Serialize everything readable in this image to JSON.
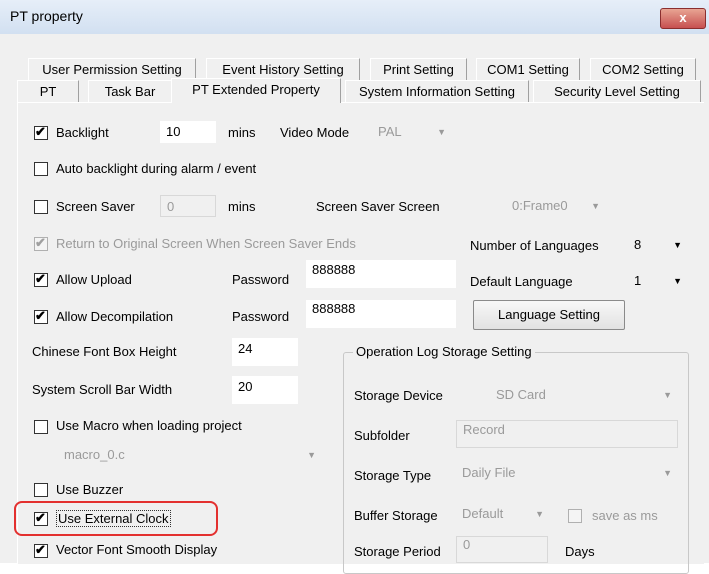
{
  "window": {
    "title": "PT property",
    "close_label": "x"
  },
  "tabs": {
    "row1": [
      "User Permission Setting",
      "Event History Setting",
      "Print Setting",
      "COM1 Setting",
      "COM2 Setting"
    ],
    "row2": [
      "PT",
      "Task Bar",
      "PT Extended Property",
      "System Information Setting",
      "Security Level Setting"
    ],
    "active": "PT Extended Property"
  },
  "backlight": {
    "label": "Backlight",
    "checked": true,
    "value": "10",
    "unit": "mins"
  },
  "video_mode": {
    "label": "Video Mode",
    "value": "PAL"
  },
  "auto_backlight": {
    "label": "Auto backlight during alarm / event",
    "checked": false
  },
  "screen_saver": {
    "label": "Screen Saver",
    "checked": false,
    "value": "0",
    "unit": "mins",
    "screen_label": "Screen Saver Screen",
    "screen_value": "0:Frame0"
  },
  "return_original": {
    "label": "Return to Original Screen When Screen Saver Ends",
    "checked": true
  },
  "languages": {
    "count_label": "Number of Languages",
    "count_value": "8",
    "default_label": "Default Language",
    "default_value": "1",
    "setting_button": "Language Setting"
  },
  "allow_upload": {
    "label": "Allow Upload",
    "checked": true,
    "password_label": "Password",
    "password": "888888"
  },
  "allow_decompilation": {
    "label": "Allow Decompilation",
    "checked": true,
    "password_label": "Password",
    "password": "888888"
  },
  "chinese_font": {
    "label": "Chinese Font Box Height",
    "value": "24"
  },
  "scroll_bar": {
    "label": "System Scroll Bar Width",
    "value": "20"
  },
  "macro": {
    "label": "Use Macro when loading project",
    "checked": false,
    "file": "macro_0.c"
  },
  "buzzer": {
    "label": "Use Buzzer",
    "checked": false
  },
  "external_clock": {
    "label": "Use External Clock",
    "checked": true
  },
  "vector_font": {
    "label": "Vector Font Smooth Display",
    "checked": true
  },
  "oplog": {
    "title": "Operation Log Storage Setting",
    "device_label": "Storage Device",
    "device_value": "SD Card",
    "subfolder_label": "Subfolder",
    "subfolder_value": "Record",
    "type_label": "Storage Type",
    "type_value": "Daily File",
    "buffer_label": "Buffer Storage",
    "buffer_value": "Default",
    "save_ms_label": "save as ms",
    "save_ms_checked": false,
    "period_label": "Storage Period",
    "period_value": "0",
    "period_unit": "Days"
  }
}
